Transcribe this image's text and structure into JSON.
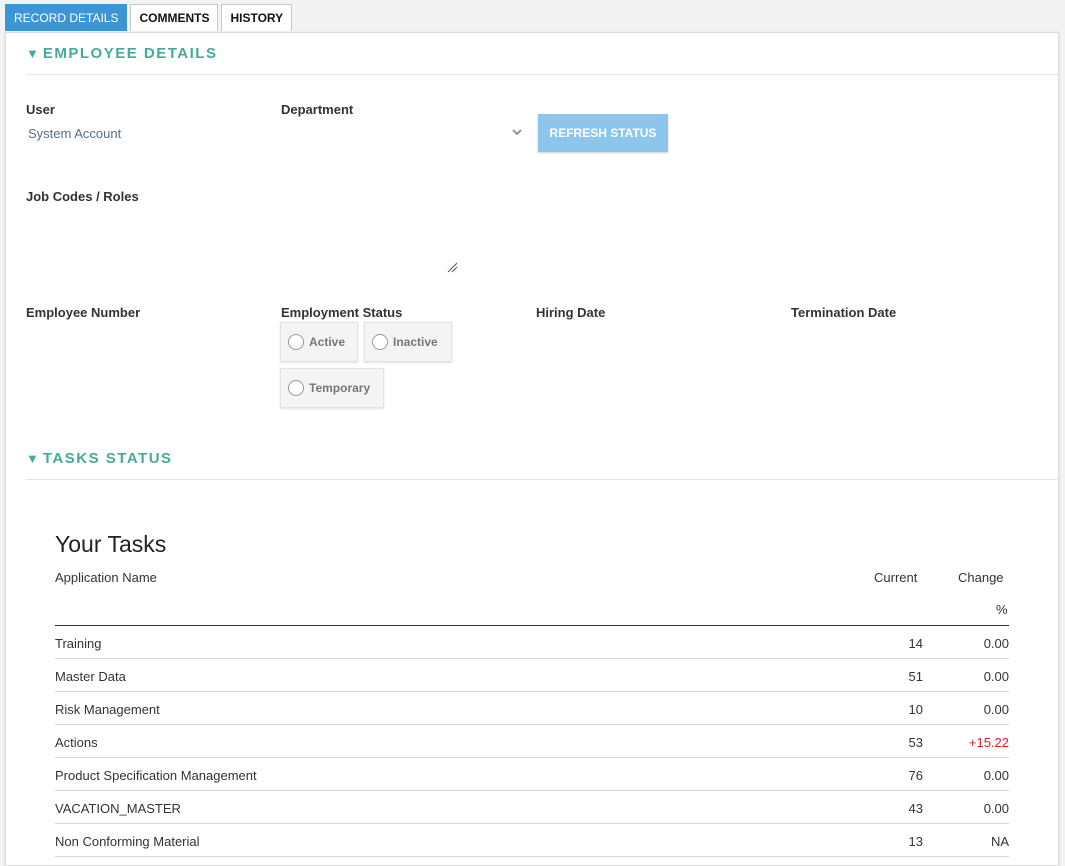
{
  "tabs": [
    {
      "label": "RECORD DETAILS"
    },
    {
      "label": "COMMENTS"
    },
    {
      "label": "HISTORY"
    }
  ],
  "employee_details": {
    "heading": "EMPLOYEE DETAILS",
    "user_label": "User",
    "user_value": "System Account",
    "department_label": "Department",
    "refresh_button": "REFRESH STATUS",
    "job_codes_label": "Job Codes / Roles",
    "employee_number_label": "Employee Number",
    "employment_status_label": "Employment Status",
    "status_options": [
      "Active",
      "Inactive",
      "Temporary"
    ],
    "hiring_date_label": "Hiring Date",
    "termination_date_label": "Termination Date"
  },
  "tasks_status": {
    "heading": "TASKS STATUS",
    "table_title": "Your Tasks",
    "col_app": "Application Name",
    "col_current": "Current",
    "col_change": "Change",
    "col_change_unit": "%",
    "rows": [
      {
        "name": "Training",
        "current": "14",
        "change": "0.00"
      },
      {
        "name": "Master Data",
        "current": "51",
        "change": "0.00"
      },
      {
        "name": "Risk Management",
        "current": "10",
        "change": "0.00"
      },
      {
        "name": "Actions",
        "current": "53",
        "change": "+15.22"
      },
      {
        "name": "Product Specification Management",
        "current": "76",
        "change": "0.00"
      },
      {
        "name": "VACATION_MASTER",
        "current": "43",
        "change": "0.00"
      },
      {
        "name": "Non Conforming Material",
        "current": "13",
        "change": "NA"
      }
    ]
  },
  "colors": {
    "accent": "#46aa9b",
    "active_tab": "#3c96d6",
    "refresh_button": "#8ec5ec",
    "positive_change": "#e02020"
  }
}
